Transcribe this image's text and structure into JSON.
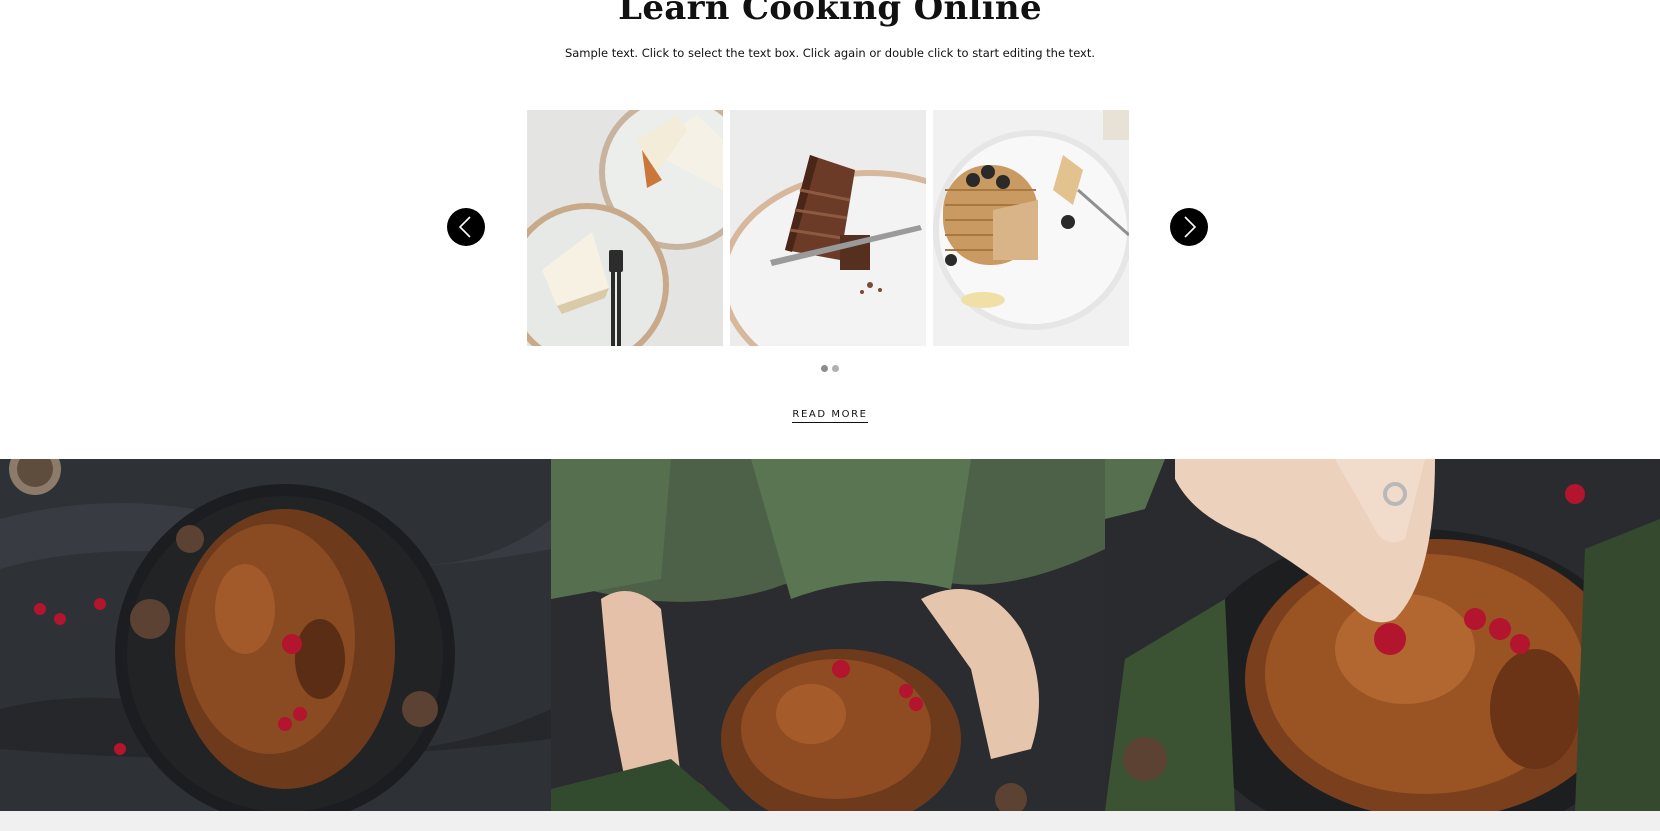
{
  "header": {
    "title": "Learn Cooking Online",
    "subtitle": "Sample text. Click to select the text box. Click again or double click to start editing the text."
  },
  "carousel": {
    "slides": [
      {
        "icon": "cake-slices-photo"
      },
      {
        "icon": "chocolate-cake-photo"
      },
      {
        "icon": "pancakes-photo"
      }
    ],
    "prev_icon": "chevron-left-icon",
    "next_icon": "chevron-right-icon",
    "pages": 2,
    "active_page": 1
  },
  "read_more": {
    "label": "READ MORE"
  },
  "gallery": {
    "photos": [
      {
        "icon": "roast-chicken-photo"
      },
      {
        "icon": "hands-serving-chicken-photo"
      },
      {
        "icon": "hand-garnishing-chicken-photo"
      }
    ]
  },
  "colors": {
    "text": "#111111",
    "button": "#000000",
    "dot": "#b0b0b0",
    "footer": "#f0f0f0"
  }
}
